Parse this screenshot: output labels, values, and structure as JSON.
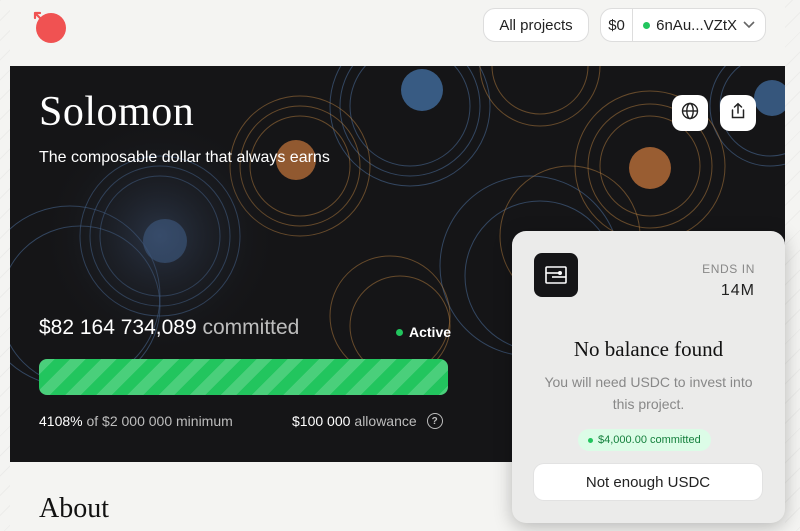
{
  "header": {
    "all_projects_label": "All projects",
    "wallet_balance": "$0",
    "wallet_address": "6nAu...VZtX",
    "accent_color": "#f05252"
  },
  "hero": {
    "title": "Solomon",
    "subtitle": "The composable dollar that always earns",
    "committed_amount": "$82 164 734,089",
    "committed_label": "committed",
    "status": "Active",
    "progress_fraction": 1.0,
    "percent": "4108%",
    "of_minimum": "of $2 000 000 minimum",
    "allowance_amount": "$100 000",
    "allowance_label": "allowance",
    "status_color": "#22c55e"
  },
  "about": {
    "heading": "About"
  },
  "card": {
    "ends_in_label": "ENDS IN",
    "ends_in_value": "14M",
    "title": "No balance found",
    "message": "You will need USDC to invest into this project.",
    "committed_tag": "$4,000.00 committed",
    "button_label": "Not enough USDC"
  },
  "icons": [
    "logo-icon",
    "chevron-down-icon",
    "globe-icon",
    "share-icon",
    "help-icon",
    "project-icon"
  ]
}
